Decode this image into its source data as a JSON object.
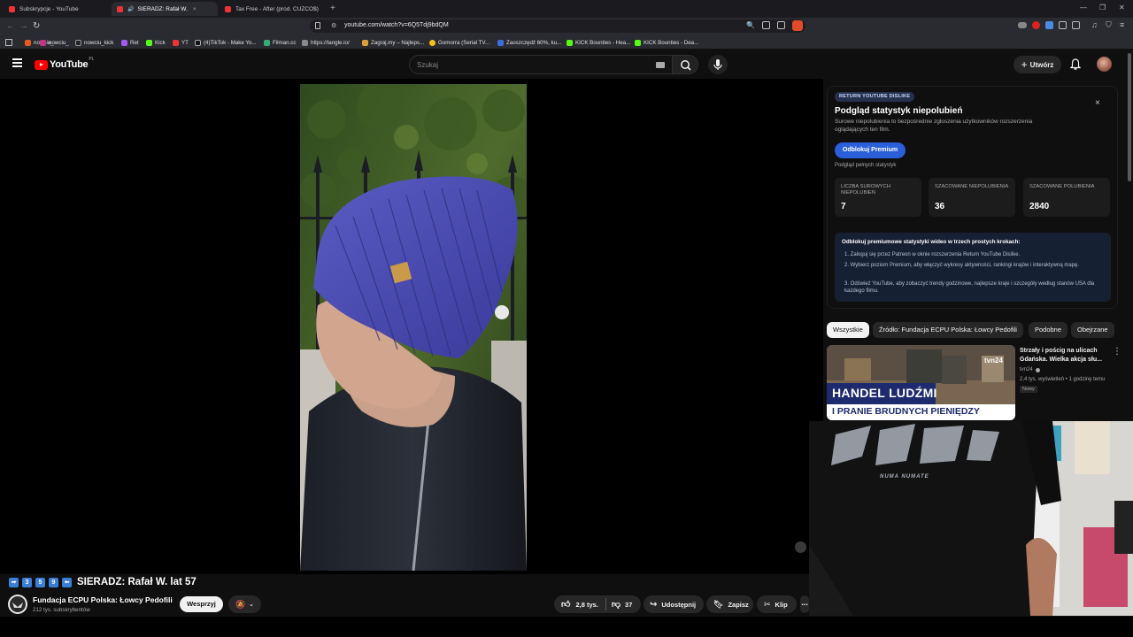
{
  "browser": {
    "tabs": [
      {
        "title": "Subskrypcje - YouTube",
        "active": false
      },
      {
        "title": "SIERADZ: Rafał W.",
        "active": true
      },
      {
        "title": "Tax Free - After (prod. CUZCO$)",
        "active": false
      }
    ],
    "new_tab": "+",
    "url": "youtube.com/watch?v=6Q5Tdj9bdQM",
    "bookmarks": [
      "nowciu_",
      "nowciu_kick",
      "Ret",
      "Kick",
      "YT",
      "(4)TikTok - Make Yo...",
      "Filman.cc",
      "https://tangle.io/",
      "Zagraj.my – Najleps...",
      "Gomorra (Serial TV...",
      "Zaoszczędź 60%, ku...",
      "KICK Bounties - Hea...",
      "KICK Bounties - Dea..."
    ]
  },
  "youtube": {
    "logo_text": "YouTube",
    "logo_region": "PL",
    "search_placeholder": "Szukaj",
    "create_label": "Utwórz"
  },
  "ryd": {
    "badge": "RETURN YOUTUBE DISLIKE",
    "heading": "Podgląd statystyk niepolubień",
    "description": "Surowe niepolubienia to bezpośrednie zgłoszenia użytkowników rozszerzenia oglądających ten film.",
    "unlock_button": "Odblokuj Premium",
    "preview_link": "Podgląd pełnych statystyk",
    "stats": [
      {
        "label": "Liczba surowych niepolubień",
        "value": "7"
      },
      {
        "label": "Szacowane niepolubienia",
        "value": "36"
      },
      {
        "label": "Szacowane polubienia",
        "value": "2840"
      }
    ],
    "steps_title": "Odblokuj premiumowe statystyki wideo w trzech prostych krokach:",
    "steps": [
      "1.  Zaloguj się przez Patreon w oknie rozszerzenia Return YouTube Dislike.",
      "2.  Wybierz poziom Premium, aby włączyć wykresy aktywności, rankingi krajów i interaktywną mapę.",
      "3.  Odśwież YouTube, aby zobaczyć trendy godzinowe, najlepsze kraje i szczegóły według stanów USA dla każdego filmu."
    ],
    "close": "×"
  },
  "chips": [
    "Wszystkie",
    "Źródło: Fundacja ECPU Polska: Łowcy Pedofili",
    "Podobne",
    "Obejrzane"
  ],
  "recommended": [
    {
      "title": "Strzały i pościg na ulicach Gdańska. Wielka akcja słu...",
      "channel": "tvn24",
      "meta": "2,4 tys. wyświetleń • 1 godzinę temu",
      "badge": "Nowy",
      "thumb_line1": "HANDEL LUDŹMI",
      "thumb_line2": "I PRANIE BRUDNYCH PIENIĘDZY",
      "thumb_logo": "tvn24"
    }
  ],
  "video": {
    "title_numbers": [
      "3",
      "5",
      "9"
    ],
    "title": "SIERADZ: Rafał W. lat 57",
    "channel": "Fundacja ECPU Polska: Łowcy Pedofili",
    "subscribers": "212 tys. subskrybentów",
    "support_button": "Wesprzyj",
    "likes": "2,8 tys.",
    "dislikes": "37",
    "share": "Udostępnij",
    "save": "Zapisz",
    "clip": "Klip"
  },
  "webcam": {
    "shirt_text": "NUMA NUMATE"
  },
  "colors": {
    "bg": "#0f0f0f",
    "youtube_red": "#ff0000",
    "accent_blue": "#3ea6ff",
    "ryd_button": "#2b5fd9"
  }
}
